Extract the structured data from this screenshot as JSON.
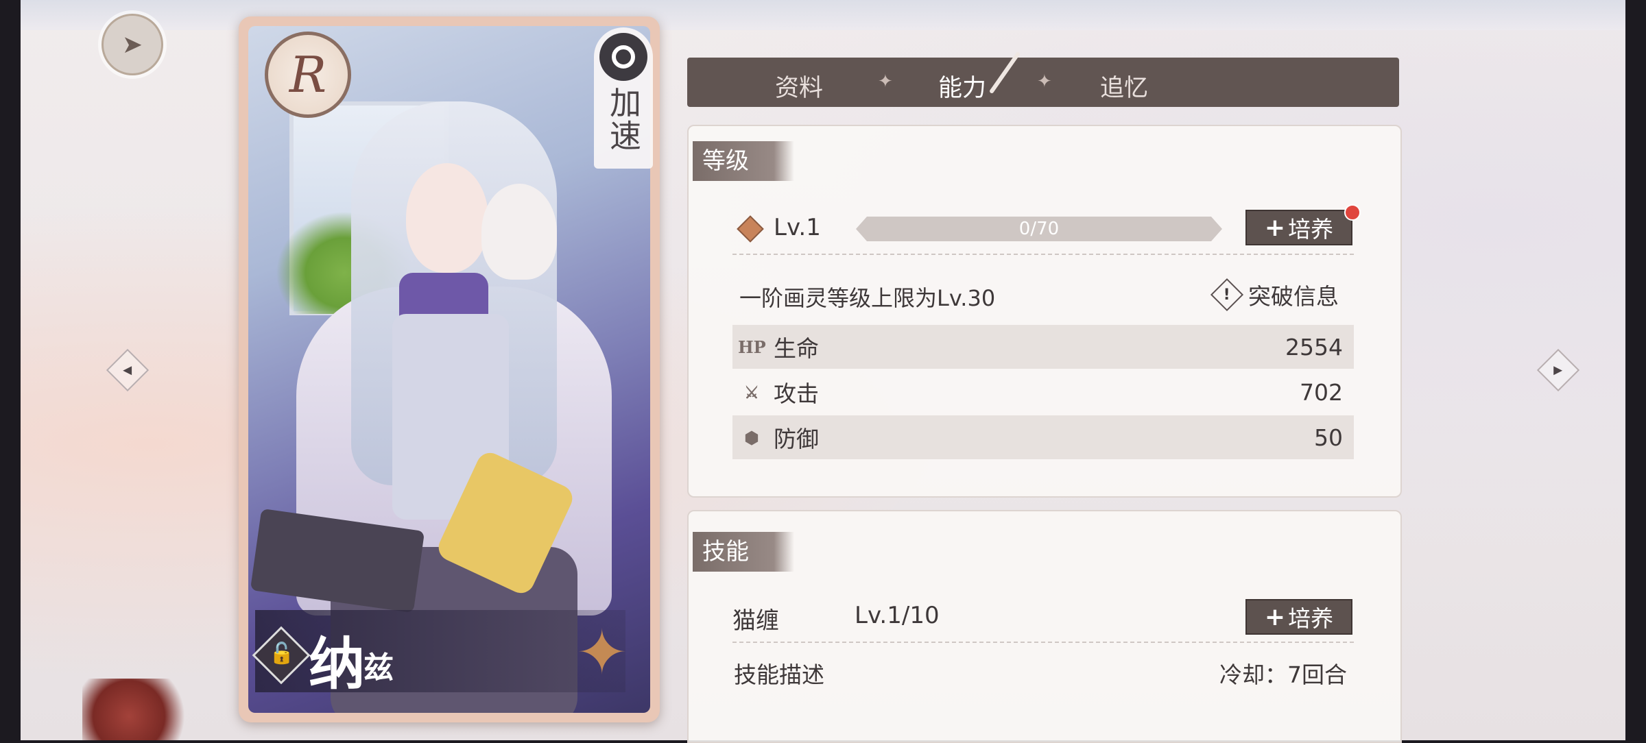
{
  "card": {
    "rarity": "R",
    "type_label": "加速",
    "name": "纳",
    "name_suffix": "兹"
  },
  "tabs": [
    {
      "label": "资料",
      "active": false
    },
    {
      "label": "能力",
      "active": true
    },
    {
      "label": "追忆",
      "active": false
    }
  ],
  "level_section": {
    "title": "等级",
    "level_label": "Lv.1",
    "xp_text": "0/70",
    "xp_progress": 0,
    "train_button": "培养",
    "cap_text": "一阶画灵等级上限为Lv.30",
    "break_info": "突破信息",
    "stats": [
      {
        "icon": "HP",
        "label": "生命",
        "value": "2554"
      },
      {
        "icon": "⚔",
        "label": "攻击",
        "value": "702"
      },
      {
        "icon": "⬢",
        "label": "防御",
        "value": "50"
      }
    ]
  },
  "skill_section": {
    "title": "技能",
    "skill_name": "猫缠",
    "skill_level": "Lv.1/10",
    "train_button": "培养",
    "desc_label": "技能描述",
    "cooldown": "冷却：7回合"
  },
  "colors": {
    "tab_bar": "#615552",
    "accent_red": "#e0453d",
    "button": "#5d524f"
  }
}
